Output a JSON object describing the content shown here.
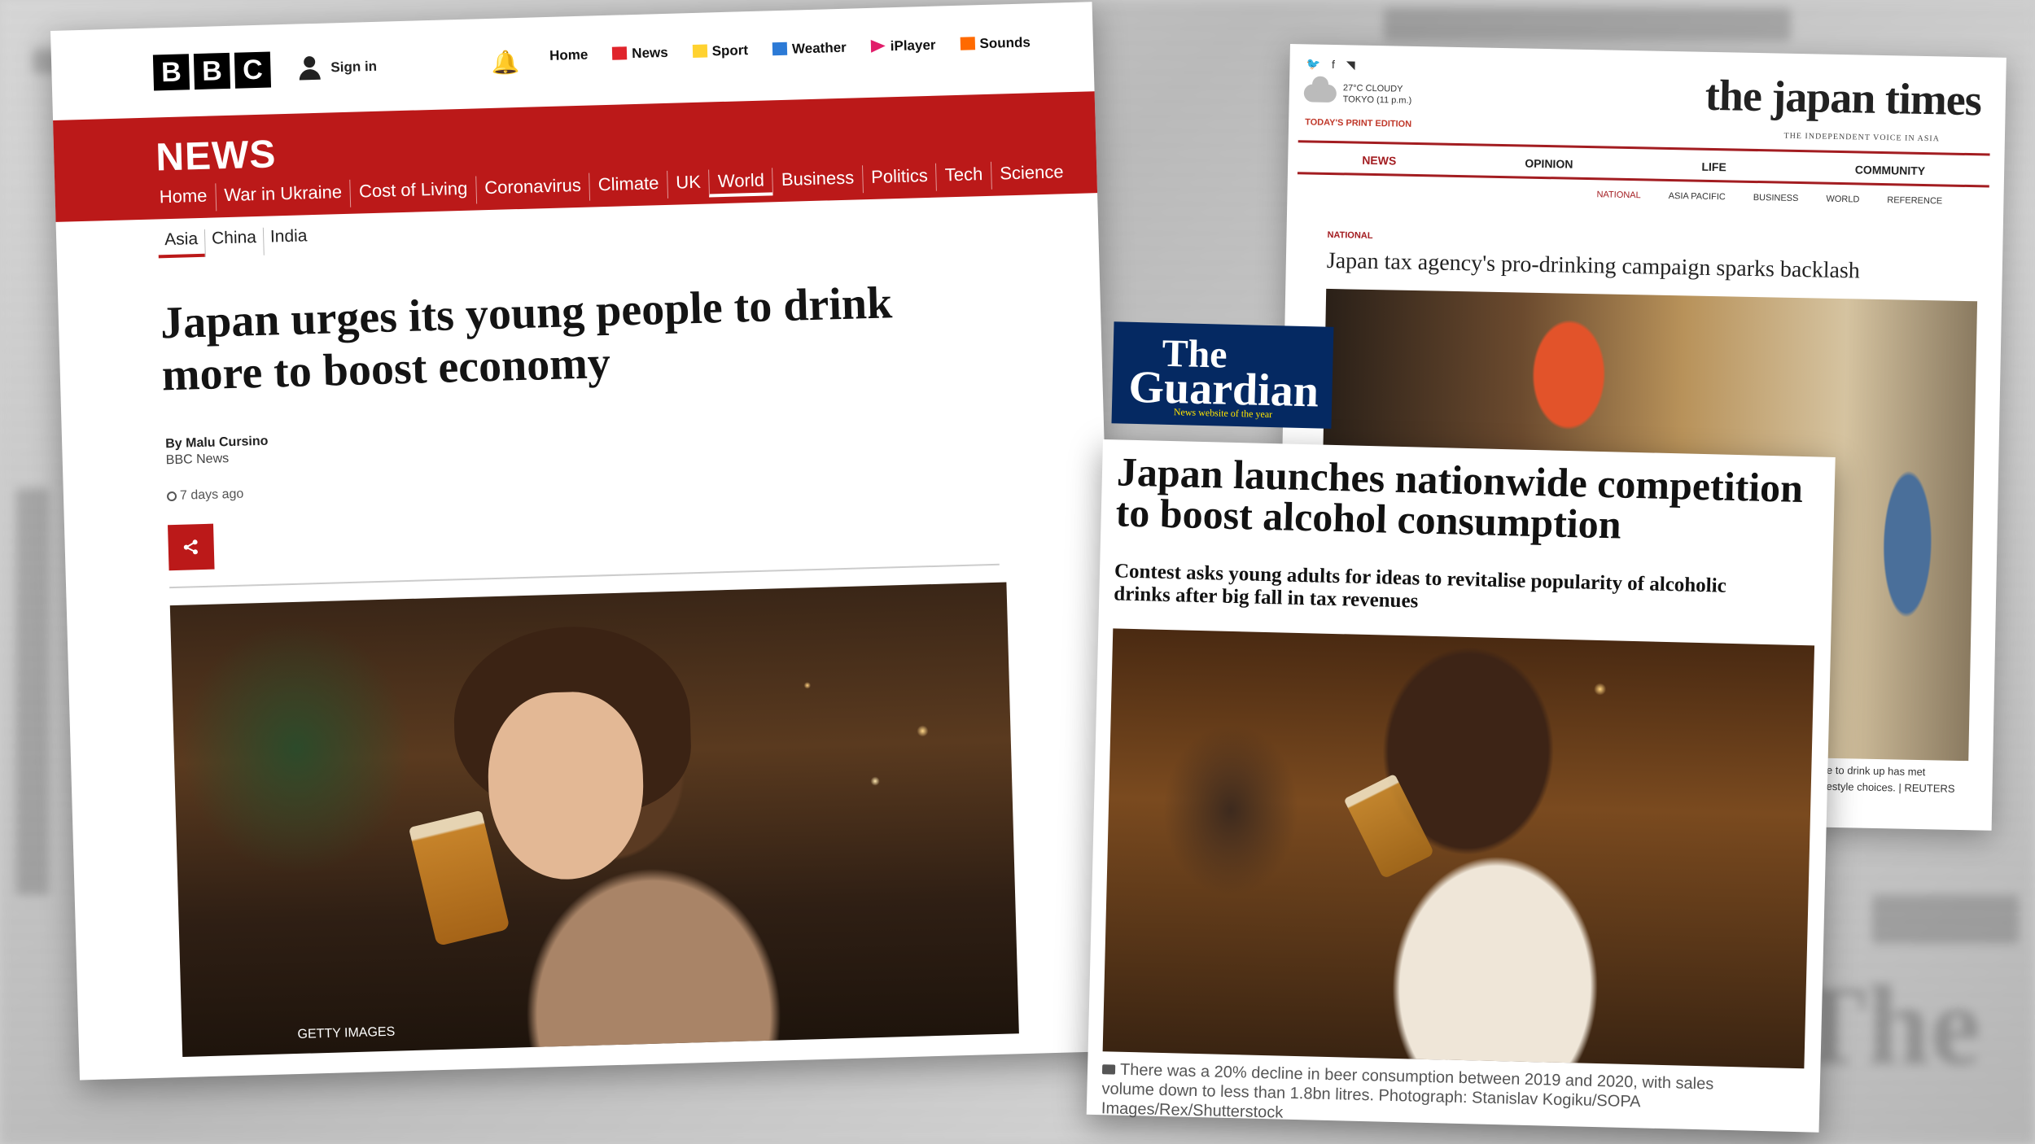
{
  "bbc": {
    "logo": [
      "B",
      "B",
      "C"
    ],
    "sign_in": "Sign in",
    "top_nav": [
      {
        "label": "Home",
        "color": ""
      },
      {
        "label": "News",
        "color": "#e0242b"
      },
      {
        "label": "Sport",
        "color": "#ffd230"
      },
      {
        "label": "Weather",
        "color": "#2c7ad6"
      },
      {
        "label": "iPlayer",
        "color": "#e11d6a"
      },
      {
        "label": "Sounds",
        "color": "#ff6a00"
      }
    ],
    "section": "NEWS",
    "nav": [
      "Home",
      "War in Ukraine",
      "Cost of Living",
      "Coronavirus",
      "Climate",
      "UK",
      "World",
      "Business",
      "Politics",
      "Tech",
      "Science"
    ],
    "active_nav": "World",
    "sub_nav": [
      "Asia",
      "China",
      "India"
    ],
    "headline": "Japan urges its young people to drink more to boost economy",
    "byline": "By Malu Cursino",
    "org": "BBC News",
    "time": "7 days ago",
    "photo_credit": "GETTY IMAGES",
    "accent": "#bb1919"
  },
  "japan_times": {
    "weather_line1": "27°C CLOUDY",
    "weather_line2": "TOKYO (11 p.m.)",
    "print_edition": "TODAY'S PRINT EDITION",
    "logo": "the japan times",
    "tagline": "THE INDEPENDENT VOICE IN ASIA",
    "nav": [
      "NEWS",
      "OPINION",
      "LIFE",
      "COMMUNITY"
    ],
    "sub_nav": [
      "NATIONAL",
      "ASIA PACIFIC",
      "BUSINESS",
      "WORLD",
      "REFERENCE"
    ],
    "section": "NATIONAL",
    "headline": "Japan tax agency's pro-drinking campaign sparks backlash",
    "caption_line1": "e to drink up has met",
    "caption_line2": "estyle choices. | REUTERS",
    "accent": "#a31d21"
  },
  "guardian": {
    "logo_line1": "The",
    "logo_line2": "Guardian",
    "logo_tag": "News website of the year",
    "headline": "Japan launches nationwide competition to boost alcohol consumption",
    "standfirst": "Contest asks young adults for ideas to revitalise popularity of alcoholic drinks after big fall in tax revenues",
    "caption": "There was a 20% decline in beer consumption between 2019 and 2020, with sales volume down to less than 1.8bn litres. Photograph: Stanislav Kogiku/SOPA Images/Rex/Shutterstock",
    "brand_color": "#052962"
  }
}
